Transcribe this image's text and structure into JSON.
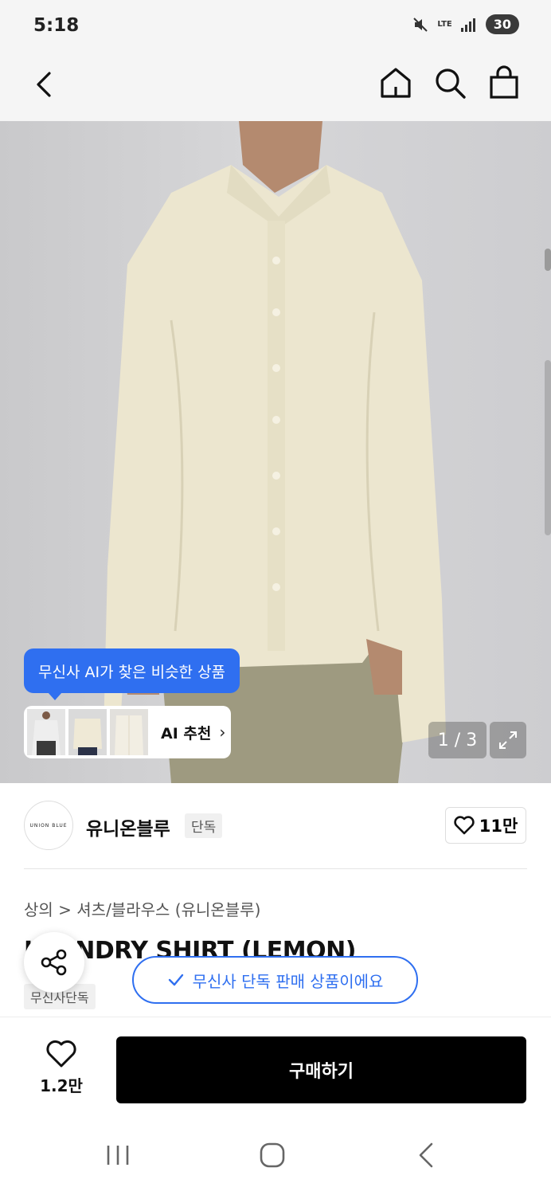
{
  "status_bar": {
    "time": "5:18",
    "network": "LTE",
    "battery": "30"
  },
  "top_nav": {
    "icons": [
      "back-icon",
      "home-icon",
      "search-icon",
      "shopping-bag-icon"
    ]
  },
  "gallery": {
    "ai_bubble": "무신사 AI가 찾은 비슷한 상품",
    "ai_recommend_label": "AI 추천",
    "pager": "1 / 3"
  },
  "brand": {
    "logo_text": "UNION BLUE",
    "name": "유니온블루",
    "tag": "단독",
    "like_count": "11만"
  },
  "product": {
    "breadcrumb": "상의 > 셔츠/블라우스 (유니온블루)",
    "title": "LAUNDRY SHIRT (LEMON)",
    "exclusive_tag": "무신사단독"
  },
  "toast": {
    "text": "무신사 단독 판매 상품이에요"
  },
  "buy_bar": {
    "wish_count": "1.2만",
    "buy_label": "구매하기"
  },
  "colors": {
    "accent": "#2f6ff0",
    "buy_button": "#000000",
    "shirt": "#ece6cf"
  }
}
